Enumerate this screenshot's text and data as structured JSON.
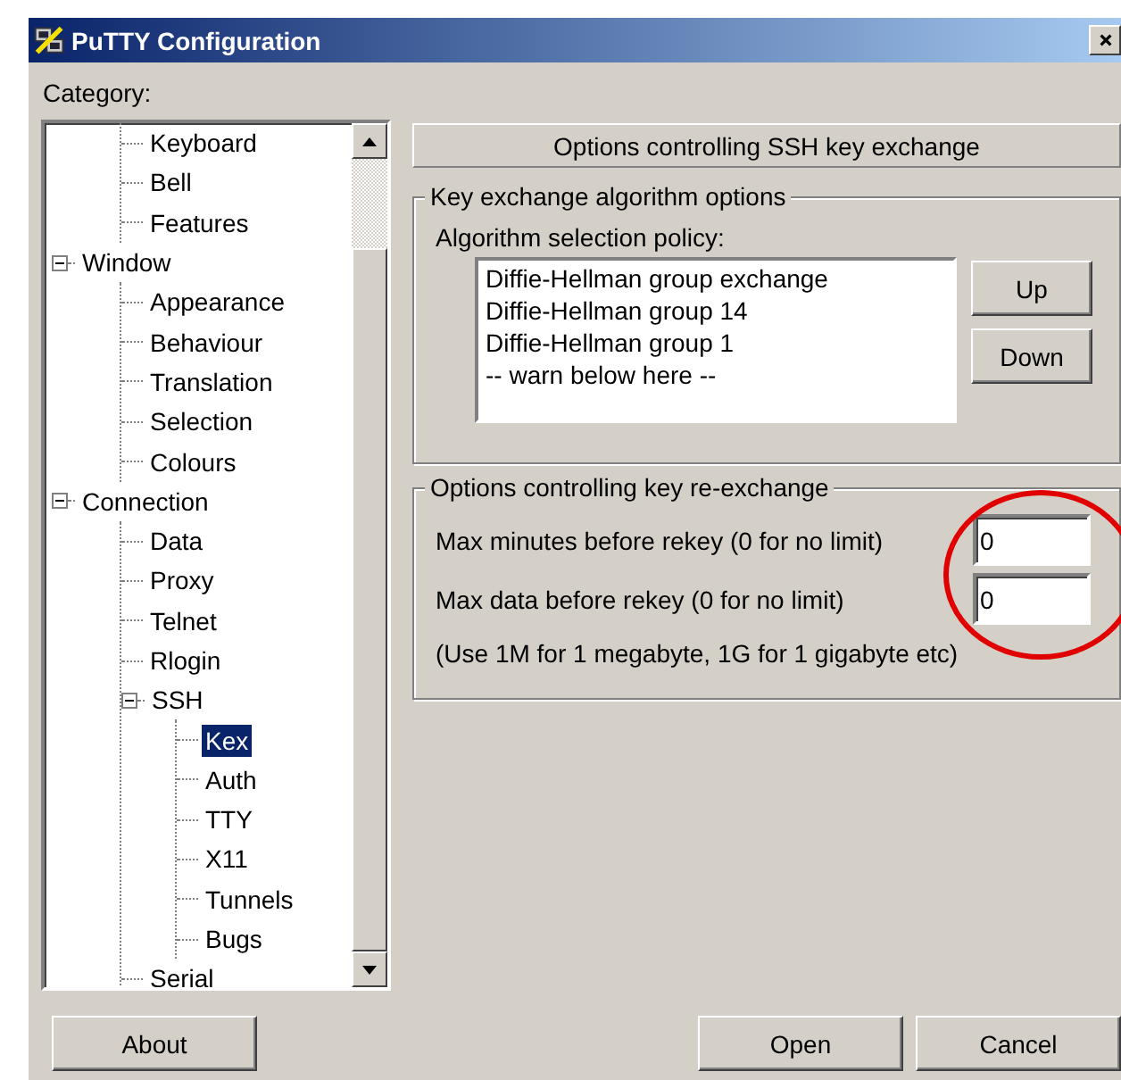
{
  "window": {
    "title": "PuTTY Configuration"
  },
  "category_label": "Category:",
  "tree": [
    {
      "children": [
        {
          "label": "Keyboard",
          "selected": false
        },
        {
          "label": "Bell",
          "selected": false
        },
        {
          "label": "Features",
          "selected": false
        }
      ]
    },
    {
      "label": "Window",
      "expanded": true,
      "selected": false,
      "children": [
        {
          "label": "Appearance",
          "selected": false
        },
        {
          "label": "Behaviour",
          "selected": false
        },
        {
          "label": "Translation",
          "selected": false
        },
        {
          "label": "Selection",
          "selected": false
        },
        {
          "label": "Colours",
          "selected": false
        }
      ]
    },
    {
      "label": "Connection",
      "expanded": true,
      "selected": false,
      "children": [
        {
          "label": "Data",
          "selected": false
        },
        {
          "label": "Proxy",
          "selected": false
        },
        {
          "label": "Telnet",
          "selected": false
        },
        {
          "label": "Rlogin",
          "selected": false
        },
        {
          "label": "SSH",
          "expanded": true,
          "selected": false,
          "children": [
            {
              "label": "Kex",
              "selected": true
            },
            {
              "label": "Auth",
              "selected": false
            },
            {
              "label": "TTY",
              "selected": false
            },
            {
              "label": "X11",
              "selected": false
            },
            {
              "label": "Tunnels",
              "selected": false
            },
            {
              "label": "Bugs",
              "selected": false
            }
          ]
        },
        {
          "label": "Serial",
          "selected": false
        }
      ]
    }
  ],
  "panel_header": "Options controlling SSH key exchange",
  "kex_group": {
    "title": "Key exchange algorithm options",
    "list_label": "Algorithm selection policy:",
    "algorithms": [
      "Diffie-Hellman group exchange",
      "Diffie-Hellman group 14",
      "Diffie-Hellman group 1",
      "-- warn below here --"
    ],
    "buttons": [
      "Up",
      "Down"
    ]
  },
  "rekey_group": {
    "title": "Options controlling key re-exchange",
    "fields": [
      {
        "label": "Max minutes before rekey (0 for no limit)",
        "value": "0"
      },
      {
        "label": "Max data before rekey (0 for no limit)",
        "value": "0"
      }
    ],
    "note": "(Use 1M for 1 megabyte, 1G for 1 gigabyte etc)"
  },
  "buttons": {
    "about": "About",
    "open": "Open",
    "cancel": "Cancel"
  }
}
